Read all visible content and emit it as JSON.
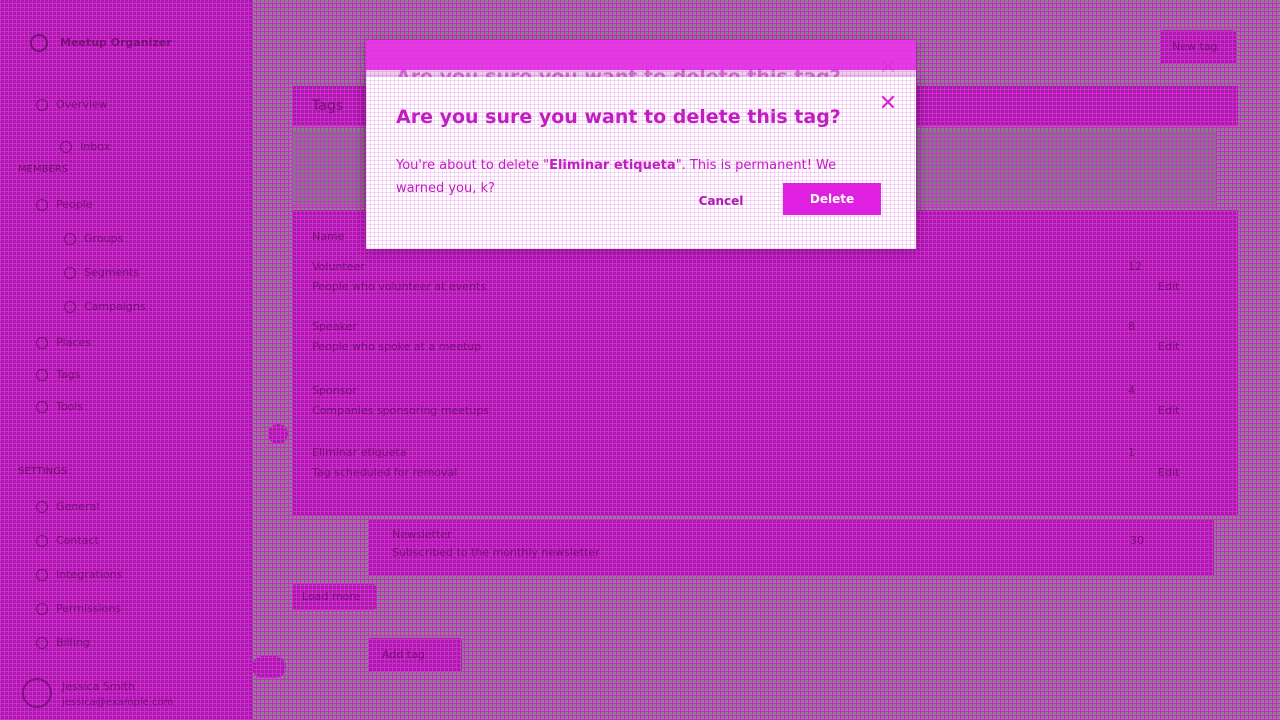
{
  "app": {
    "org_name": "Meetup Organizer",
    "header_button": "New tag"
  },
  "sidebar": {
    "top_items": [
      {
        "label": "Overview",
        "icon": "home-icon"
      },
      {
        "label": "Inbox",
        "icon": "inbox-icon"
      }
    ],
    "section_1": "MEMBERS",
    "members_items": [
      {
        "label": "People",
        "icon": "people-icon"
      },
      {
        "label": "Groups",
        "icon": "groups-icon"
      },
      {
        "label": "Segments",
        "icon": "segments-icon"
      },
      {
        "label": "Campaigns",
        "icon": "campaigns-icon"
      },
      {
        "label": "Places",
        "icon": "map-pin-icon"
      },
      {
        "label": "Tags",
        "icon": "tag-icon"
      },
      {
        "label": "Tools",
        "icon": "wrench-icon"
      }
    ],
    "section_2": "SETTINGS",
    "settings_items": [
      {
        "label": "General",
        "icon": "gear-icon"
      },
      {
        "label": "Contact",
        "icon": "pencil-icon"
      },
      {
        "label": "Integrations",
        "icon": "plug-icon"
      },
      {
        "label": "Permissions",
        "icon": "lock-icon"
      },
      {
        "label": "Billing",
        "icon": "card-icon"
      }
    ],
    "user_name": "Jessica Smith",
    "user_email": "jessica@example.com"
  },
  "main": {
    "page_title": "Tags",
    "table_header": "Name",
    "rows": [
      {
        "name": "Volunteer",
        "desc": "People who volunteer at events",
        "count": "12",
        "action": "Edit"
      },
      {
        "name": "Speaker",
        "desc": "People who spoke at a meetup",
        "count": "8",
        "action": "Edit"
      },
      {
        "name": "Sponsor",
        "desc": "Companies sponsoring meetups",
        "count": "4",
        "action": "Edit"
      },
      {
        "name": "Eliminar etiqueta",
        "desc": "Tag scheduled for removal",
        "count": "1",
        "action": "Edit"
      },
      {
        "name": "Newsletter",
        "desc": "Subscribed to the monthly newsletter",
        "count": "30",
        "action": "Edit"
      }
    ],
    "pager_label": "Load more",
    "footer_button": "Add tag"
  },
  "dialog": {
    "title": "Are you sure you want to delete this tag?",
    "body_prefix": "You're about to delete \"",
    "tag_name": "Eliminar etiqueta",
    "body_suffix": "\". This is permanent! We warned you, k?",
    "cancel_label": "Cancel",
    "delete_label": "Delete",
    "close_icon": "close-icon"
  },
  "colors": {
    "accent": "#e020e0",
    "text_accent": "#c21cc2"
  }
}
